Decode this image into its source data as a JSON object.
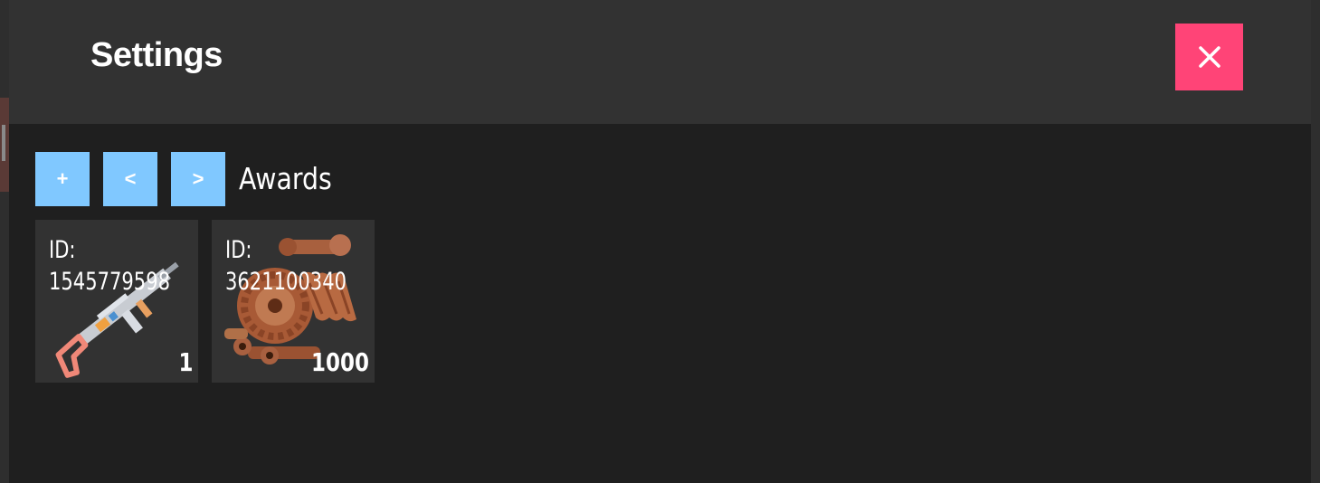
{
  "window": {
    "title": "Settings",
    "close_icon": "close-icon",
    "close_color": "#ff4477"
  },
  "toolbar": {
    "add_label": "+",
    "prev_label": "<",
    "next_label": ">",
    "section_title": "Awards",
    "button_color": "#80c8ff"
  },
  "awards": [
    {
      "id_label": "ID:",
      "id_value": "1545779598",
      "quantity": "1",
      "icon": "assault-rifle-icon"
    },
    {
      "id_label": "ID:",
      "id_value": "3621100340",
      "quantity": "1000",
      "icon": "metal-fragments-icon"
    }
  ]
}
